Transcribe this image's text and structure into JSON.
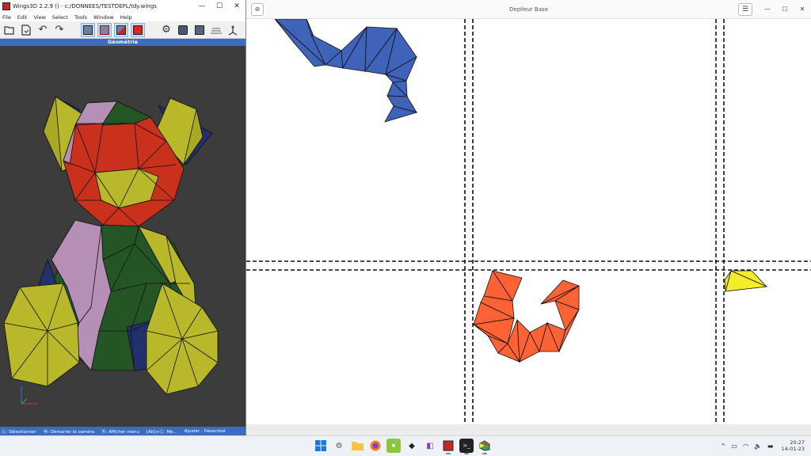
{
  "wings": {
    "title": "Wings3D 2.2.9 () - c:/DONNEES/TESTDEPL/tdy.wings",
    "controls": {
      "minimize": "—",
      "maximize": "☐",
      "close": "✕"
    },
    "menu": [
      "File",
      "Edit",
      "View",
      "Select",
      "Tools",
      "Window",
      "Help"
    ],
    "geometry_label": "Géométrie",
    "status": [
      "Ⓛ: Sélectionner",
      "Ⓜ: Démarrer la caméra",
      "Ⓡ: Afficher menu",
      "[Alt]+Ⓛ: Me...",
      "Ajuster : Désactivé"
    ]
  },
  "deplieur": {
    "title": "Deplieur Base",
    "menu_icon": "☰",
    "controls": {
      "minimize": "—",
      "maximize": "☐",
      "close": "✕"
    }
  },
  "taskbar": {
    "apps": [
      "windows-start",
      "settings",
      "file-explorer",
      "firefox",
      "office",
      "inkscape",
      "visual-studio",
      "wings3d",
      "terminal",
      "deplieur"
    ],
    "tray_caret": "^",
    "time": "20:27",
    "date": "14-01-23"
  },
  "colors": {
    "wings_blue": "#3b6cc2",
    "piece_blue": "#3f63b8",
    "piece_orange": "#ff6235",
    "piece_yellow": "#f2ec2a",
    "bear_red": "#c9311d",
    "bear_yellow": "#b8b82a",
    "bear_green": "#245525",
    "bear_pink": "#b58fb6",
    "bear_navy": "#23306e"
  }
}
